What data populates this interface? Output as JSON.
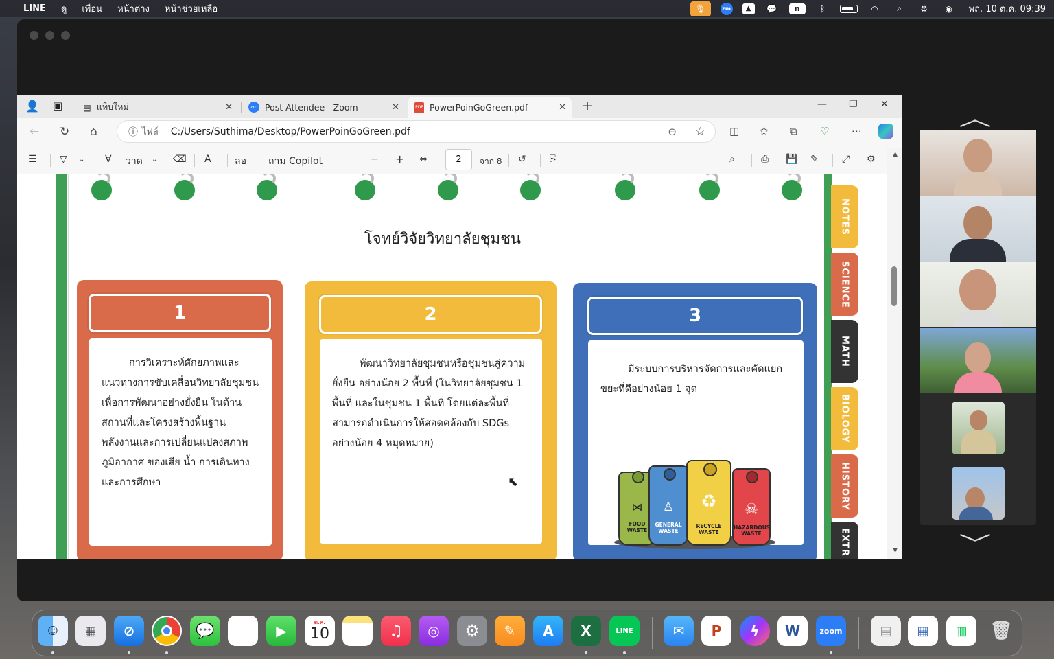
{
  "menubar": {
    "apple_icon": "apple-icon",
    "app_name": "LINE",
    "menus": [
      "ดู",
      "เพื่อน",
      "หน้าต่าง",
      "หน้าช่วยเหลือ"
    ],
    "clock": "พฤ. 10 ต.ค. 09:39",
    "zoom_badge": "zm",
    "n_badge": "n"
  },
  "browser": {
    "tabs": [
      {
        "label": "แท็บใหม่",
        "icon": "new-tab-icon"
      },
      {
        "label": "Post Attendee - Zoom",
        "icon": "zoom-icon"
      },
      {
        "label": "PowerPoinGoGreen.pdf",
        "icon": "pdf-icon"
      }
    ],
    "address": {
      "scheme_label": "ไฟล์",
      "url": "C:/Users/Suthima/Desktop/PowerPoinGoGreen.pdf"
    },
    "pdf_toolbar": {
      "draw_label": "วาด",
      "read_aloud_label": "ลอ",
      "copilot_label": "ถาม Copilot",
      "page_current": "2",
      "page_of_label": "จาก 8"
    }
  },
  "pdf": {
    "title": "โจทย์วิจัยวิทยาลัยชุมชน",
    "cards": [
      {
        "number": "1",
        "color": "#d96a4a",
        "text": "การวิเคราะห์ศักยภาพและแนวทางการขับเคลื่อนวิทยาลัยชุมชนเพื่อการพัฒนาอย่างยั่งยืน ในด้านสถานที่และโครงสร้างพื้นฐาน พลังงานและการเปลี่ยนแปลงสภาพภูมิอากาศ ของเสีย น้ำ การเดินทางและการศึกษา"
      },
      {
        "number": "2",
        "color": "#f3bb3c",
        "text": "พัฒนาวิทยาลัยชุมชนหรือชุมชนสู่ความยั่งยืน อย่างน้อย 2 พื้นที่ (ในวิทยาลัยชุมชน 1 พื้นที่ และในชุมชน 1 พื้นที่ โดยแต่ละพื้นที่สามารถดำเนินการให้สอดคล้องกับ SDGs อย่างน้อย 4 หมุดหมาย)"
      },
      {
        "number": "3",
        "color": "#3e6fb8",
        "text": "มีระบบการบริหารจัดการและคัดแยกขยะที่ดีอย่างน้อย 1 จุด"
      }
    ],
    "bins": [
      {
        "label": "FOOD WASTE",
        "color": "#9ab849"
      },
      {
        "label": "GENERAL WASTE",
        "color": "#4f8fd0"
      },
      {
        "label": "RECYCLE WASTE",
        "color": "#f2d046"
      },
      {
        "label": "HAZARDOUS WASTE",
        "color": "#e2454a"
      }
    ],
    "side_tabs": [
      {
        "label": "NOTES",
        "color": "#f3bb3c"
      },
      {
        "label": "SCIENCE",
        "color": "#d96a4a"
      },
      {
        "label": "MATH",
        "color": "#333333"
      },
      {
        "label": "BIOLOGY",
        "color": "#f3bb3c"
      },
      {
        "label": "HISTORY",
        "color": "#d96a4a"
      },
      {
        "label": "EXTR",
        "color": "#333333"
      }
    ]
  },
  "participants": {
    "count_visible": 6
  },
  "dock": {
    "apps": [
      "Finder",
      "Launchpad",
      "Safari",
      "Chrome",
      "Messages",
      "Photos",
      "FaceTime",
      "Calendar",
      "Notes",
      "Music",
      "Podcasts",
      "System Settings",
      "Pages",
      "App Store",
      "Excel",
      "LINE",
      "Mail",
      "PowerPoint",
      "Messenger",
      "Word",
      "Zoom"
    ],
    "calendar_month": "ต.ค.",
    "calendar_day": "10",
    "zoom_label": "zoom",
    "line_label": "LINE"
  }
}
